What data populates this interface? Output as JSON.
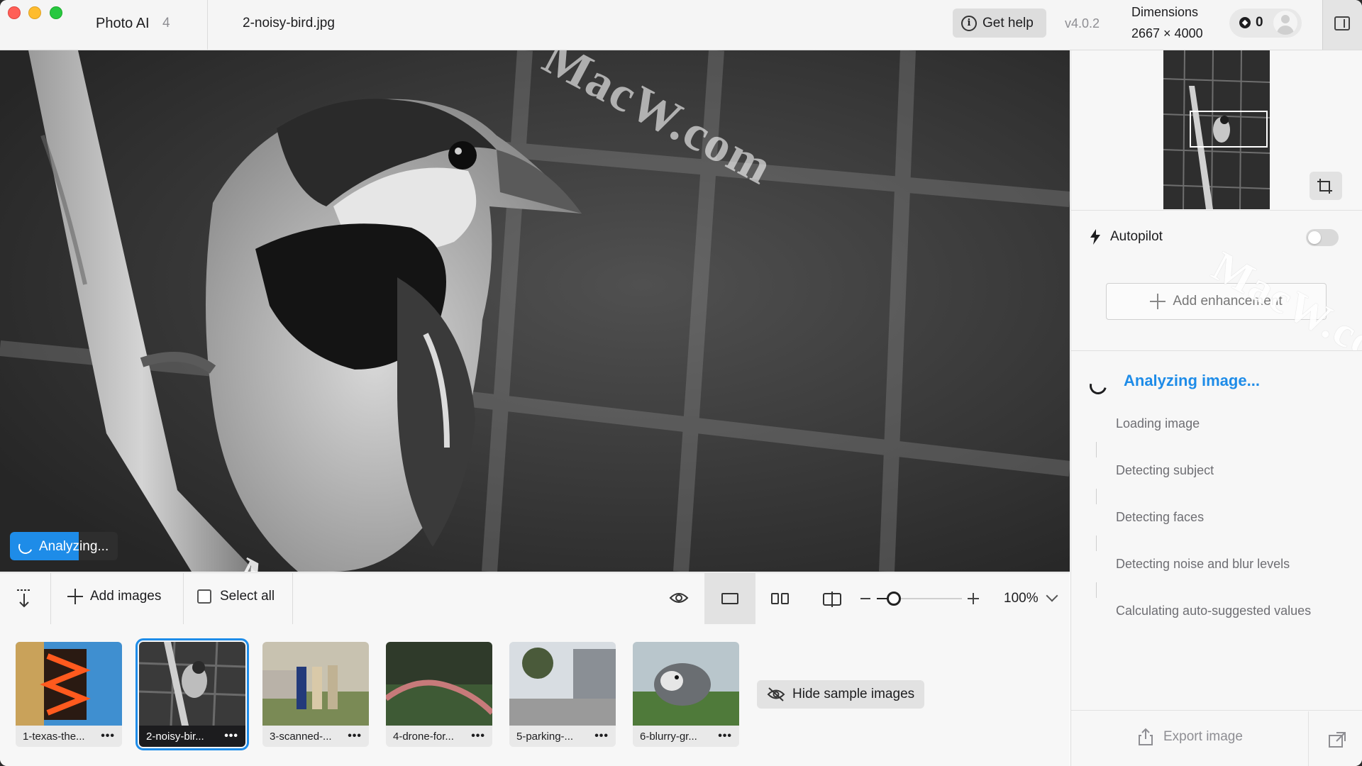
{
  "window": {
    "app_name": "Photo AI",
    "app_badge": "4",
    "file_name": "2-noisy-bird.jpg",
    "help_label": "Get help",
    "version": "v4.0.2",
    "dimensions_label": "Dimensions",
    "dimensions_value": "2667 × 4000",
    "credits": "0"
  },
  "viewer": {
    "status_label": "Analyzing...",
    "progress_fraction": 0.64,
    "watermark": "MacW.com"
  },
  "toolbar": {
    "add_images": "Add images",
    "select_all": "Select all",
    "zoom_level": "100%",
    "zoom_slider_fraction": 0.2
  },
  "filmstrip": {
    "items": [
      {
        "label": "1-texas-the...",
        "selected": false
      },
      {
        "label": "2-noisy-bir...",
        "selected": true
      },
      {
        "label": "3-scanned-...",
        "selected": false
      },
      {
        "label": "4-drone-for...",
        "selected": false
      },
      {
        "label": "5-parking-...",
        "selected": false
      },
      {
        "label": "6-blurry-gr...",
        "selected": false
      }
    ],
    "hide_samples": "Hide sample images"
  },
  "panel": {
    "autopilot_label": "Autopilot",
    "autopilot_on": false,
    "add_enhancement": "Add enhancement",
    "analyzing_title": "Analyzing image...",
    "steps": [
      "Loading image",
      "Detecting subject",
      "Detecting faces",
      "Detecting noise and blur levels",
      "Calculating auto-suggested values"
    ],
    "export_label": "Export image",
    "watermark": "MacW.com"
  },
  "colors": {
    "accent": "#1e8ce8",
    "panel_bg": "#f7f7f7"
  }
}
